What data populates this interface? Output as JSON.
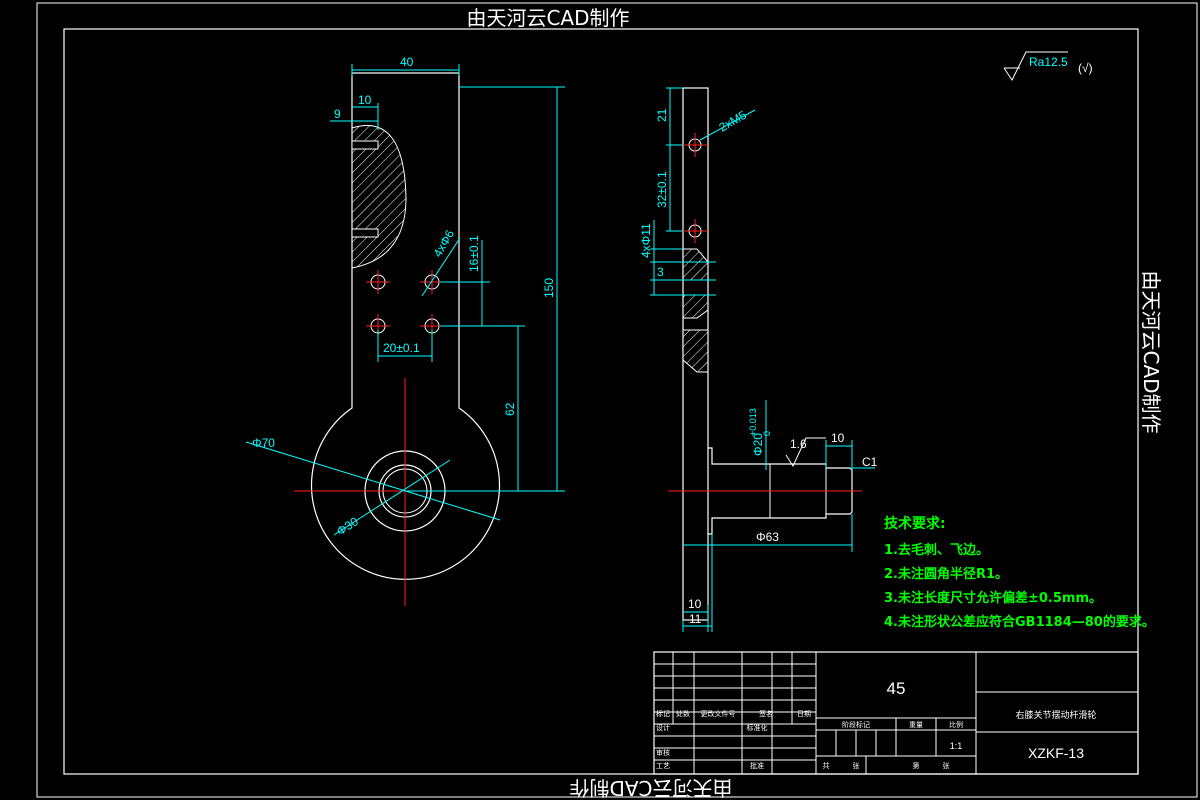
{
  "colors": {
    "background": "#000000",
    "outline": "#ffffff",
    "dimension": "#00ffff",
    "centerline": "#ff2020",
    "notes": "#00ff00",
    "watermark": "#ffffff"
  },
  "watermark": {
    "text": "由天河云CAD制作"
  },
  "roughness": {
    "value": "Ra12.5",
    "suffix": "(√)"
  },
  "front_view": {
    "dims": {
      "width_top": "40",
      "step_10": "10",
      "step_9": "9",
      "height_150": "150",
      "holes": "4xΦ6",
      "spacing_v": "16±0.1",
      "spacing_h": "20±0.1",
      "dist_62": "62",
      "dia_70": "Φ70",
      "dia_30": "Φ30"
    }
  },
  "side_view": {
    "dims": {
      "d21": "21",
      "thread": "2xM5",
      "d32": "32±0.1",
      "holes11": "4xΦ11",
      "d3": "3",
      "shaft_dia": "Φ20",
      "tol_up": "+0.013",
      "tol_low": "0",
      "rough_16": "1.6",
      "d10_top": "10",
      "chamfer": "C1",
      "dia_63": "Φ63",
      "d10_bottom": "10",
      "d11_bottom": "11"
    }
  },
  "tech_notes": {
    "title": "技术要求:",
    "items": [
      "1.去毛刺、飞边。",
      "2.未注圆角半径R1。",
      "3.未注长度尺寸允许偏差±0.5mm。",
      "4.未注形状公差应符合GB1184—80的要求。"
    ]
  },
  "title_block": {
    "material": "45",
    "part_name": "右膝关节摆动杆滑轮",
    "drawing_no": "XZKF-13",
    "scale": "1:1",
    "labels": {
      "biaoji": "标记",
      "chushu": "处数",
      "fenqu": "更改文件号",
      "qianming": "签名",
      "riqi": "日期",
      "sheji": "设计",
      "biaozhunhua": "标准化",
      "shenhe": "审核",
      "gongyi": "工艺",
      "pizhun": "批准",
      "jieduan": "阶段标记",
      "zhongliang": "重量",
      "bili": "比例",
      "gong": "共",
      "zhang1": "张",
      "di": "第",
      "zhang2": "张"
    }
  }
}
